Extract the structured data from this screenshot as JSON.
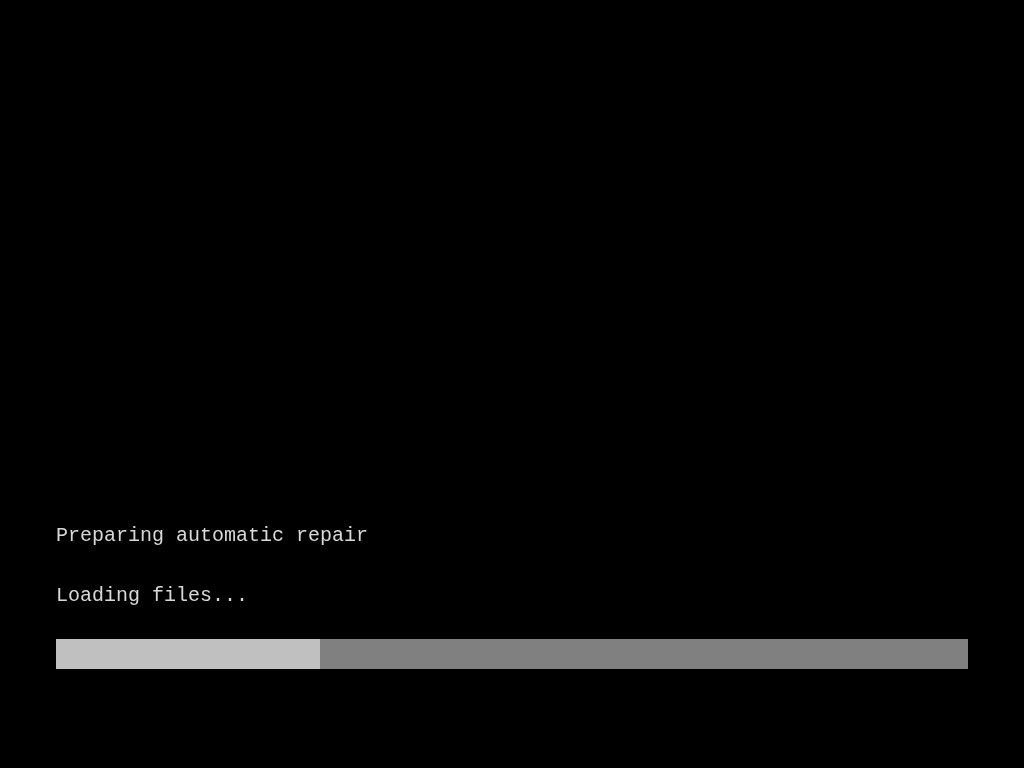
{
  "title": "Preparing automatic repair",
  "status": "Loading files...",
  "progress": {
    "level": 0.29
  }
}
